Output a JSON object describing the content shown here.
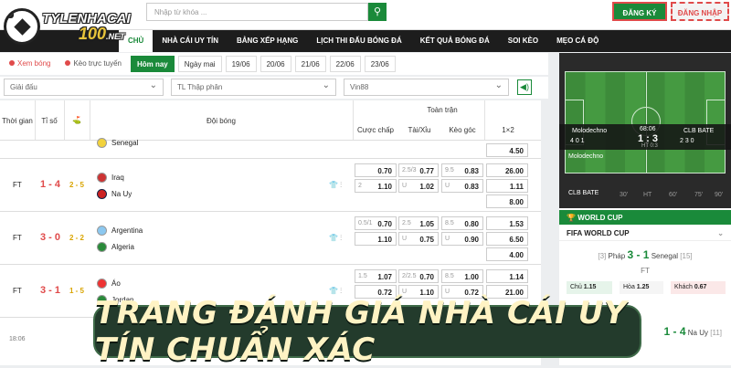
{
  "brand": {
    "text1": "TYLENHACAI",
    "text2": "100",
    "suffix": ".NET"
  },
  "search": {
    "placeholder": "Nhập từ khóa ..."
  },
  "auth": {
    "register": "ĐĂNG KÝ",
    "login": "ĐĂNG NHẬP"
  },
  "nav": [
    "CHỦ",
    "NHÀ CÁI UY TÍN",
    "BẢNG XẾP HẠNG",
    "LỊCH THI ĐẤU BÓNG ĐÁ",
    "KẾT QUẢ BÓNG ĐÁ",
    "SOI KÈO",
    "MẸO CÁ ĐỘ"
  ],
  "filters": {
    "live_score": "Xem bóng",
    "live_tv": "Kèo trực tuyến",
    "today": "Hôm nay",
    "tomorrow": "Ngày mai",
    "dates": [
      "19/06",
      "20/06",
      "21/06",
      "22/06",
      "23/06"
    ]
  },
  "selects": {
    "league": "Giải đấu",
    "odds_format": "TL Thập phân",
    "bookmaker": "Vin88"
  },
  "table": {
    "headers": {
      "time": "Thời gian",
      "score": "Tỉ số",
      "corner": "⛳",
      "teams": "Đội bóng",
      "full_match": "Toàn trận",
      "handicap": "Cược chấp",
      "over_under": "Tài/Xỉu",
      "corners": "Kèo góc",
      "x12": "1×2"
    },
    "rows": [
      {
        "time": "",
        "score": "",
        "half": "",
        "home": "Senegal",
        "away": "",
        "ob": [],
        "x12": [
          "4.50"
        ]
      },
      {
        "time": "FT",
        "score": "1 - 4",
        "half": "2 - 5",
        "home": "Iraq",
        "away": "Na Uy",
        "ob": [
          [
            "",
            "0.70"
          ],
          [
            "2.5/3",
            "0.77"
          ],
          [
            "9.5",
            "0.83"
          ],
          [
            "2",
            "1.10"
          ],
          [
            "U",
            "1.02"
          ],
          [
            "U",
            "0.83"
          ]
        ],
        "x12": [
          "26.00",
          "1.11",
          "8.00"
        ]
      },
      {
        "time": "FT",
        "score": "3 - 0",
        "half": "2 - 2",
        "home": "Argentina",
        "away": "Algeria",
        "ob": [
          [
            "0.5/1",
            "0.70"
          ],
          [
            "2.5",
            "1.05"
          ],
          [
            "8.5",
            "0.80"
          ],
          [
            "",
            "1.10"
          ],
          [
            "U",
            "0.75"
          ],
          [
            "U",
            "0.90"
          ]
        ],
        "x12": [
          "1.53",
          "6.50",
          "4.00"
        ]
      },
      {
        "time": "FT",
        "score": "3 - 1",
        "half": "1 - 5",
        "home": "Áo",
        "away": "Jordan",
        "ob": [
          [
            "1.5",
            "1.07"
          ],
          [
            "2/2.5",
            "0.70"
          ],
          [
            "8.5",
            "1.00"
          ],
          [
            "",
            "0.72"
          ],
          [
            "U",
            "1.10"
          ],
          [
            "U",
            "0.72"
          ]
        ],
        "x12": [
          "1.14",
          "21.00"
        ]
      },
      {
        "time": "18:06",
        "score": "",
        "half": "",
        "home": "",
        "away": "",
        "ob": [],
        "x12": []
      }
    ]
  },
  "live": {
    "home": "Molodechno",
    "away": "CLB BATE",
    "minute": "68:06",
    "score": "1 : 3",
    "ht": "HT 0:3",
    "home_stats": "4 0 1",
    "away_stats": "2 3 0",
    "ticks": [
      "30'",
      "HT",
      "60'",
      "75'",
      "90'"
    ]
  },
  "worldcup": {
    "header": "WORLD CUP",
    "competition": "FIFA WORLD CUP",
    "match1": {
      "home": "Pháp",
      "home_rank": "[3]",
      "score": "3 - 1",
      "away": "Senegal",
      "away_rank": "[15]",
      "status": "FT"
    },
    "odds": {
      "home_label": "Chủ",
      "home": "1.15",
      "draw_label": "Hòa",
      "draw": "1.25",
      "away_label": "Khách",
      "away": "0.67"
    },
    "match2": {
      "home": "",
      "score": "1 - 4",
      "away": "Na Uy",
      "away_rank": "[11]",
      "status": "FT"
    }
  },
  "banner": "TRANG ĐÁNH GIÁ NHÀ CÁI UY TÍN CHUẨN XÁC",
  "colors": {
    "primary": "#1a8a3a",
    "score": "#e04a4a",
    "half": "#d9a400",
    "nav": "#1d1d1d"
  }
}
